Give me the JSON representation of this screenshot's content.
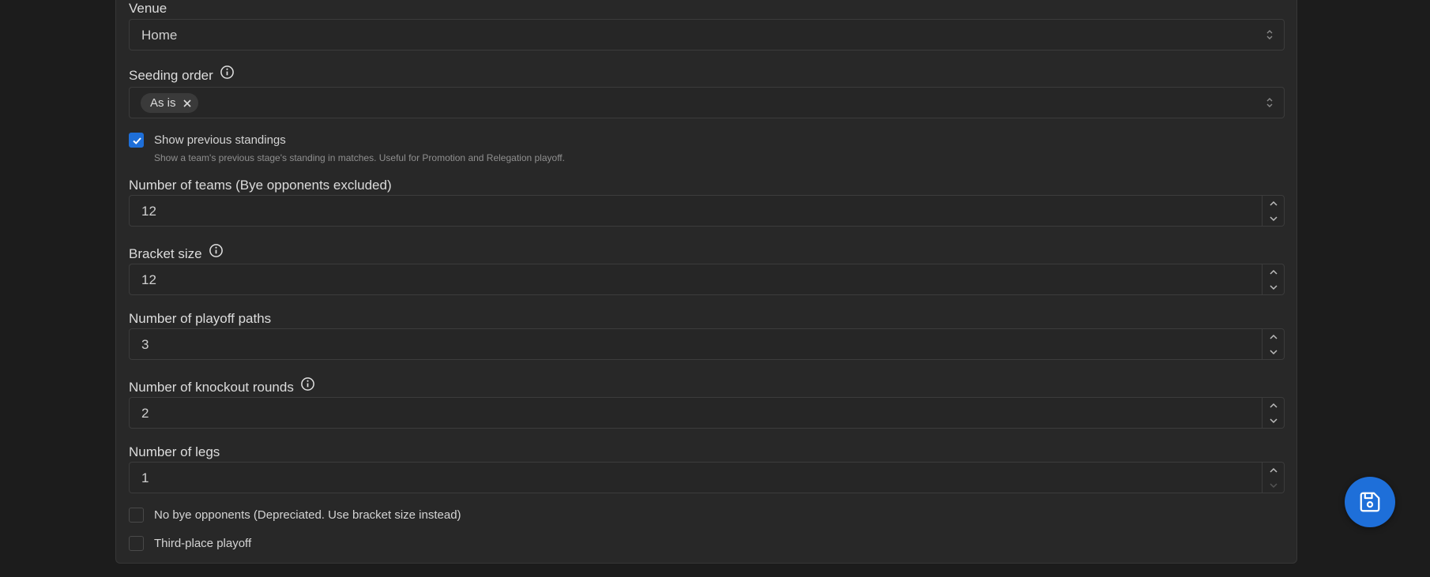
{
  "form": {
    "venue": {
      "label": "Venue",
      "value": "Home"
    },
    "seeding_order": {
      "label": "Seeding order",
      "chip": "As is"
    },
    "show_previous_standings": {
      "label": "Show previous standings",
      "description": "Show a team's previous stage's standing in matches. Useful for Promotion and Relegation playoff.",
      "checked": true
    },
    "number_of_teams": {
      "label": "Number of teams (Bye opponents excluded)",
      "value": "12"
    },
    "bracket_size": {
      "label": "Bracket size",
      "value": "12"
    },
    "playoff_paths": {
      "label": "Number of playoff paths",
      "value": "3"
    },
    "knockout_rounds": {
      "label": "Number of knockout rounds",
      "value": "2"
    },
    "legs": {
      "label": "Number of legs",
      "value": "1"
    },
    "no_bye_opponents": {
      "label": "No bye opponents (Depreciated. Use bracket size instead)",
      "checked": false
    },
    "third_place_playoff": {
      "label": "Third-place playoff",
      "checked": false
    }
  },
  "icons": {
    "info": "info-circle-icon",
    "select": "chevron-up-down-icon",
    "remove": "close-icon",
    "spin_up": "chevron-up-icon",
    "spin_down": "chevron-down-icon",
    "check": "check-icon",
    "save": "floppy-disk-icon"
  },
  "colors": {
    "accent": "#1e6fd9",
    "background": "#1c1c1c",
    "panel": "#282828"
  }
}
